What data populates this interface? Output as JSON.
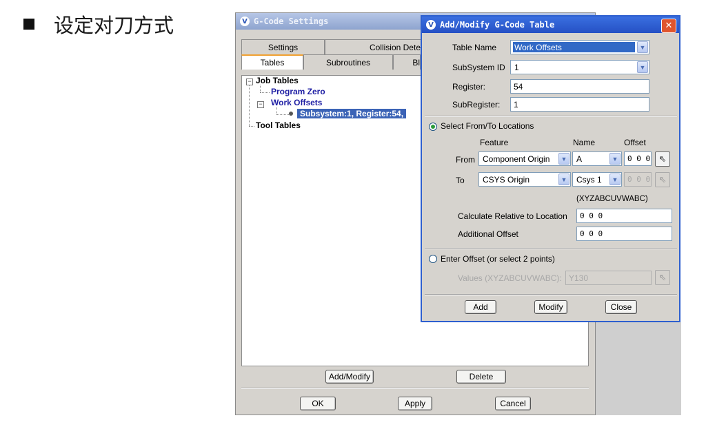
{
  "slide": {
    "title": "设定对刀方式"
  },
  "gcode_settings": {
    "title": "G-Code Settings",
    "tabs_row1": [
      "Settings",
      "Collision Dete"
    ],
    "tabs_row2": [
      "Tables",
      "Subroutines",
      "Bl"
    ],
    "tree": {
      "job_tables": "Job Tables",
      "program_zero": "Program Zero",
      "work_offsets": "Work Offsets",
      "selected_node": "Subsystem:1,   Register:54,",
      "tool_tables": "Tool Tables"
    },
    "buttons": {
      "add_modify": "Add/Modify",
      "delete": "Delete",
      "ok": "OK",
      "apply": "Apply",
      "cancel": "Cancel"
    }
  },
  "add_modify": {
    "title": "Add/Modify G-Code Table",
    "table_name_label": "Table Name",
    "table_name": "Work Offsets",
    "subsystem_label": "SubSystem ID",
    "subsystem": "1",
    "register_label": "Register:",
    "register": "54",
    "subregister_label": "SubRegister:",
    "subregister": "1",
    "select_locations_label": "Select From/To Locations",
    "select_locations_selected": true,
    "col_feature": "Feature",
    "col_name": "Name",
    "col_offset": "Offset",
    "from_label": "From",
    "from_feature": "Component Origin",
    "from_name": "A",
    "from_offset": "0 0 0",
    "to_label": "To",
    "to_feature": "CSYS Origin",
    "to_name": "Csys 1",
    "to_offset": "0 0 0",
    "axes_hint": "(XYZABCUVWABC)",
    "calc_relative_label": "Calculate Relative to Location",
    "calc_relative": "0 0 0",
    "additional_offset_label": "Additional Offset",
    "additional_offset": "0 0 0",
    "enter_offset_label": "Enter Offset (or select 2 points)",
    "values_label": "Values (XYZABCUVWABC):",
    "values": "Y130",
    "buttons": {
      "add": "Add",
      "modify": "Modify",
      "close": "Close"
    },
    "icons": {
      "pick": "pick-arrow-icon",
      "dropdown": "chevron-down-icon",
      "close": "close-icon"
    }
  }
}
